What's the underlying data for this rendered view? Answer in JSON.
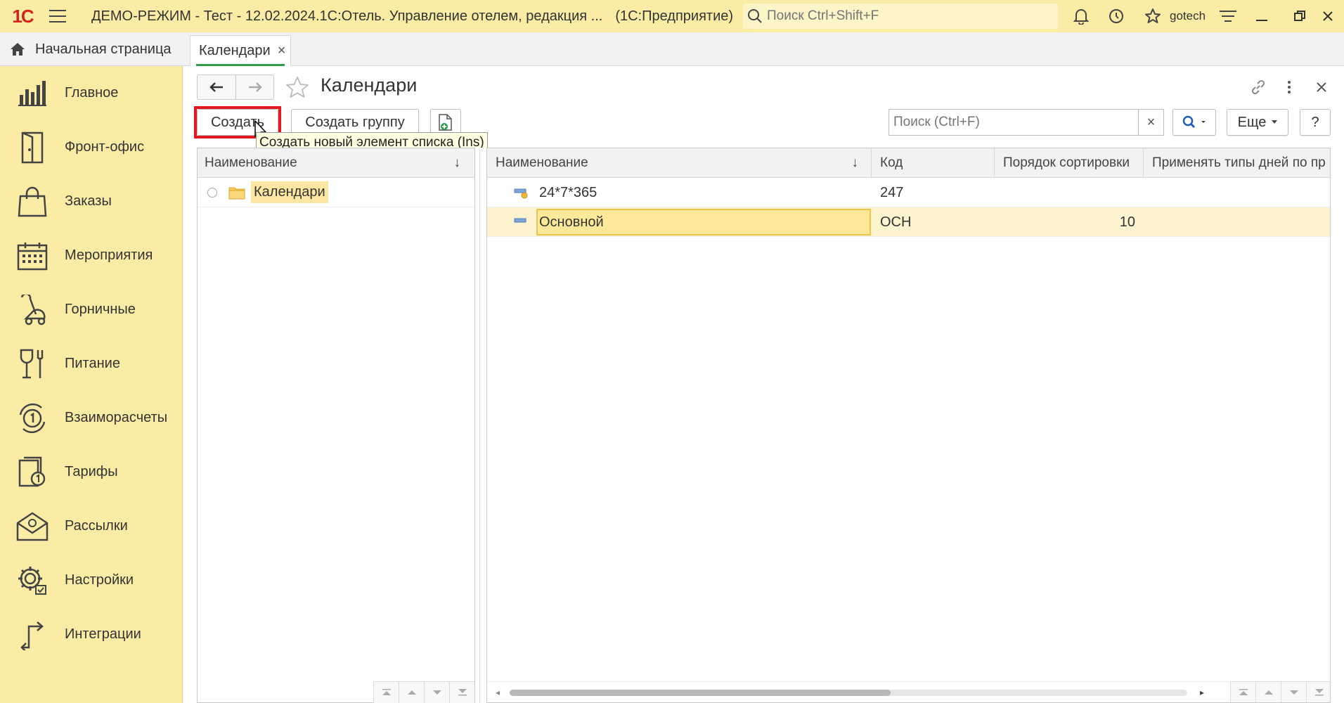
{
  "titlebar": {
    "logo": "1С",
    "title": "ДЕМО-РЕЖИМ - Тест - 12.02.2024.1С:Отель. Управление отелем, редакция ...",
    "app_suffix": "(1С:Предприятие)",
    "search_placeholder": "Поиск Ctrl+Shift+F",
    "user": "gotech"
  },
  "tabs": {
    "home": "Начальная страница",
    "active": "Календари",
    "close": "×"
  },
  "sidebar": {
    "items": [
      {
        "label": "Главное",
        "icon": "chart-bars-icon"
      },
      {
        "label": "Фронт-офис",
        "icon": "door-icon"
      },
      {
        "label": "Заказы",
        "icon": "shopping-bag-icon"
      },
      {
        "label": "Мероприятия",
        "icon": "calendar-icon"
      },
      {
        "label": "Горничные",
        "icon": "vacuum-icon"
      },
      {
        "label": "Питание",
        "icon": "glass-fork-icon"
      },
      {
        "label": "Взаиморасчеты",
        "icon": "coin-cycle-icon"
      },
      {
        "label": "Тарифы",
        "icon": "tariff-icon"
      },
      {
        "label": "Рассылки",
        "icon": "mail-icon"
      },
      {
        "label": "Настройки",
        "icon": "gear-icon"
      },
      {
        "label": "Интеграции",
        "icon": "integration-icon"
      }
    ]
  },
  "form": {
    "title": "Календари"
  },
  "toolbar": {
    "create": "Создать",
    "create_group": "Создать группу",
    "search_placeholder": "Поиск (Ctrl+F)",
    "clear": "×",
    "more": "Еще",
    "help": "?",
    "tooltip": "Создать новый элемент списка (Ins)"
  },
  "tree": {
    "header": "Наименование",
    "sort_arrow": "↓",
    "root_label": "Календари"
  },
  "list": {
    "columns": [
      "Наименование",
      "Код",
      "Порядок сортировки",
      "Применять типы дней по пр"
    ],
    "sort_arrow": "↓",
    "rows": [
      {
        "name": "24*7*365",
        "code": "247",
        "order": ""
      },
      {
        "name": "Основной",
        "code": "ОСН",
        "order": "10"
      }
    ]
  },
  "colors": {
    "panel_yellow": "#fbeca5",
    "highlight_red": "#e0191f",
    "active_tab_green": "#2e9c4b",
    "selection": "#fde99a"
  }
}
